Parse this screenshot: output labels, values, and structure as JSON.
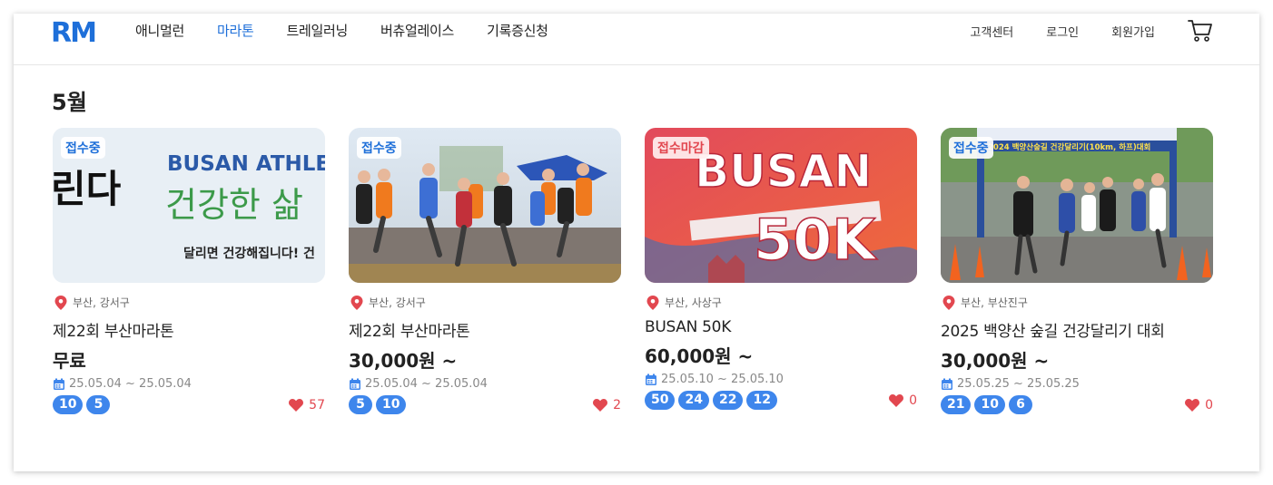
{
  "header": {
    "logo": "RM",
    "nav": [
      "애니멀런",
      "마라톤",
      "트레일러닝",
      "버츄얼레이스",
      "기록증신청"
    ],
    "active_nav": "마라톤",
    "util": [
      "고객센터",
      "로그인",
      "회원가입"
    ]
  },
  "section": {
    "month": "5월"
  },
  "cards": [
    {
      "badge": "접수중",
      "image_text": {
        "en": "BUSAN ATHLE",
        "ko1": "린다",
        "ko2": "건강한 삶",
        "ko3": "달리면 건강해집니다! 건"
      },
      "location": "부산, 강서구",
      "title": "제22회 부산마라톤",
      "price": "무료",
      "dates": "25.05.04 ~ 25.05.04",
      "distances": [
        "10",
        "5"
      ],
      "likes": "57"
    },
    {
      "badge": "접수중",
      "location": "부산, 강서구",
      "title": "제22회 부산마라톤",
      "price": "30,000원 ~",
      "dates": "25.05.04 ~ 25.05.04",
      "distances": [
        "5",
        "10"
      ],
      "likes": "2"
    },
    {
      "badge": "접수마감",
      "image_text": {
        "line1": "BUSAN",
        "line2": "50K"
      },
      "location": "부산, 사상구",
      "title": "BUSAN 50K",
      "price": "60,000원 ~",
      "dates": "25.05.10 ~ 25.05.10",
      "distances": [
        "50",
        "24",
        "22",
        "12"
      ],
      "likes": "0"
    },
    {
      "badge": "접수중",
      "image_text": {
        "banner": "2024 백양산숲길 건강달리기(10km, 하프)대회"
      },
      "location": "부산, 부산진구",
      "title": "2025 백양산 숲길 건강달리기 대회",
      "price": "30,000원 ~",
      "dates": "25.05.25 ~ 25.05.25",
      "distances": [
        "21",
        "10",
        "6"
      ],
      "likes": "0"
    }
  ],
  "colors": {
    "accent": "#1e6fd9",
    "pill": "#3e86ec",
    "heart": "#e2474f",
    "closed": "#e2474f"
  },
  "icons": [
    "cart-icon",
    "location-pin-icon",
    "calendar-icon",
    "heart-icon"
  ]
}
